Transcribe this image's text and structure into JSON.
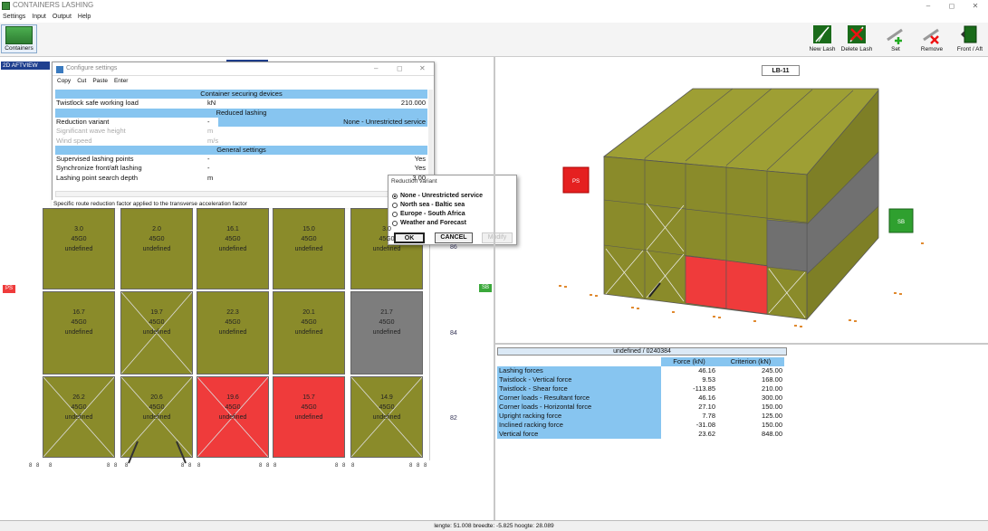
{
  "app": {
    "title": "CONTAINERS LASHING",
    "window_controls": [
      "–",
      "◻",
      "✕"
    ]
  },
  "menu": [
    "Settings",
    "Input",
    "Output",
    "Help"
  ],
  "toolbar": {
    "containers": "Containers",
    "lb_label": "LB-11",
    "buttons": [
      "New Lash",
      "Delete Lash",
      "Set",
      "Remove",
      "Front / Aft"
    ]
  },
  "view_label": "2D AFTVIEW",
  "config": {
    "title": "Configure settings",
    "menu": [
      "Copy",
      "Cut",
      "Paste",
      "Enter"
    ],
    "rows": [
      {
        "type": "header",
        "name": "Container securing devices"
      },
      {
        "type": "row",
        "name": "Twistlock safe working load",
        "unit": "kN",
        "value": "210.000"
      },
      {
        "type": "header",
        "name": "Reduced lashing"
      },
      {
        "type": "sel",
        "name": "Reduction variant",
        "unit": "-",
        "value": "None - Unrestricted service"
      },
      {
        "type": "dis",
        "name": "Significant wave height",
        "unit": "m",
        "value": ""
      },
      {
        "type": "dis",
        "name": "Wind speed",
        "unit": "m/s",
        "value": ""
      },
      {
        "type": "header",
        "name": "General settings"
      },
      {
        "type": "row",
        "name": "Supervised lashing points",
        "unit": "-",
        "value": "Yes"
      },
      {
        "type": "row",
        "name": "Synchronize front/aft lashing",
        "unit": "-",
        "value": "Yes"
      },
      {
        "type": "row",
        "name": "Lashing point search depth",
        "unit": "m",
        "value": "3.00"
      }
    ],
    "hint": "Specific route reduction factor applied to the transverse acceleration factor"
  },
  "popup": {
    "title": "Reduction variant",
    "options": [
      {
        "label": "None - Unrestricted service",
        "selected": true
      },
      {
        "label": "North sea - Baltic sea",
        "selected": false
      },
      {
        "label": "Europe - South Africa",
        "selected": false
      },
      {
        "label": "Weather and Forecast",
        "selected": false
      }
    ],
    "ok": "OK",
    "cancel": "CANCEL",
    "third": "Modify"
  },
  "bay": {
    "port_tag": "PS",
    "stbd_tag": "SB",
    "tier_labels": [
      "86",
      "84",
      "82"
    ],
    "cells": [
      [
        {
          "w": "3.0",
          "t": "45G0",
          "s": "undefined",
          "c": "olive"
        },
        {
          "w": "2.0",
          "t": "45G0",
          "s": "undefined",
          "c": "olive"
        },
        {
          "w": "16.1",
          "t": "45G0",
          "s": "undefined",
          "c": "olive"
        },
        {
          "w": "15.0",
          "t": "45G0",
          "s": "undefined",
          "c": "olive"
        },
        {
          "w": "3.0",
          "t": "45G0",
          "s": "undefined",
          "c": "olive"
        }
      ],
      [
        {
          "w": "16.7",
          "t": "45G0",
          "s": "undefined",
          "c": "olive"
        },
        {
          "w": "19.7",
          "t": "45G0",
          "s": "undefined",
          "c": "olive"
        },
        {
          "w": "22.3",
          "t": "45G0",
          "s": "undefined",
          "c": "olive"
        },
        {
          "w": "20.1",
          "t": "45G0",
          "s": "undefined",
          "c": "olive"
        },
        {
          "w": "21.7",
          "t": "45G0",
          "s": "undefined",
          "c": "grey"
        }
      ],
      [
        {
          "w": "26.2",
          "t": "45G0",
          "s": "undefined",
          "c": "olive"
        },
        {
          "w": "20.6",
          "t": "45G0",
          "s": "undefined",
          "c": "olive"
        },
        {
          "w": "19.6",
          "t": "45G0",
          "s": "undefined",
          "c": "red"
        },
        {
          "w": "15.7",
          "t": "45G0",
          "s": "undefined",
          "c": "red"
        },
        {
          "w": "14.9",
          "t": "45G0",
          "s": "undefined",
          "c": "olive"
        }
      ]
    ]
  },
  "view3d": {
    "ps_tag": "PS",
    "sb_tag": "SB"
  },
  "results": {
    "header": "undefined / 0240384",
    "col_force": "Force (kN)",
    "col_criterion": "Criterion (kN)",
    "rows": [
      {
        "name": "Lashing forces",
        "force": "46.16",
        "crit": "245.00"
      },
      {
        "name": "Twistlock - Vertical force",
        "force": "9.53",
        "crit": "168.00"
      },
      {
        "name": "Twistlock - Shear force",
        "force": "-113.85",
        "crit": "210.00"
      },
      {
        "name": "Corner loads - Resultant force",
        "force": "46.16",
        "crit": "300.00"
      },
      {
        "name": "Corner loads - Horizontal force",
        "force": "27.10",
        "crit": "150.00"
      },
      {
        "name": "Upright racking force",
        "force": "7.78",
        "crit": "125.00"
      },
      {
        "name": "Inclined racking force",
        "force": "-31.08",
        "crit": "150.00"
      },
      {
        "name": "Vertical force",
        "force": "23.62",
        "crit": "848.00"
      }
    ]
  },
  "status": "lengte: 51.008 breedte: -5.825 hoogte: 28.089",
  "colors": {
    "olive": "#8a8b2a",
    "grey": "#7d7d7d",
    "red": "#ef3b3b",
    "accent": "#87c5f0"
  }
}
